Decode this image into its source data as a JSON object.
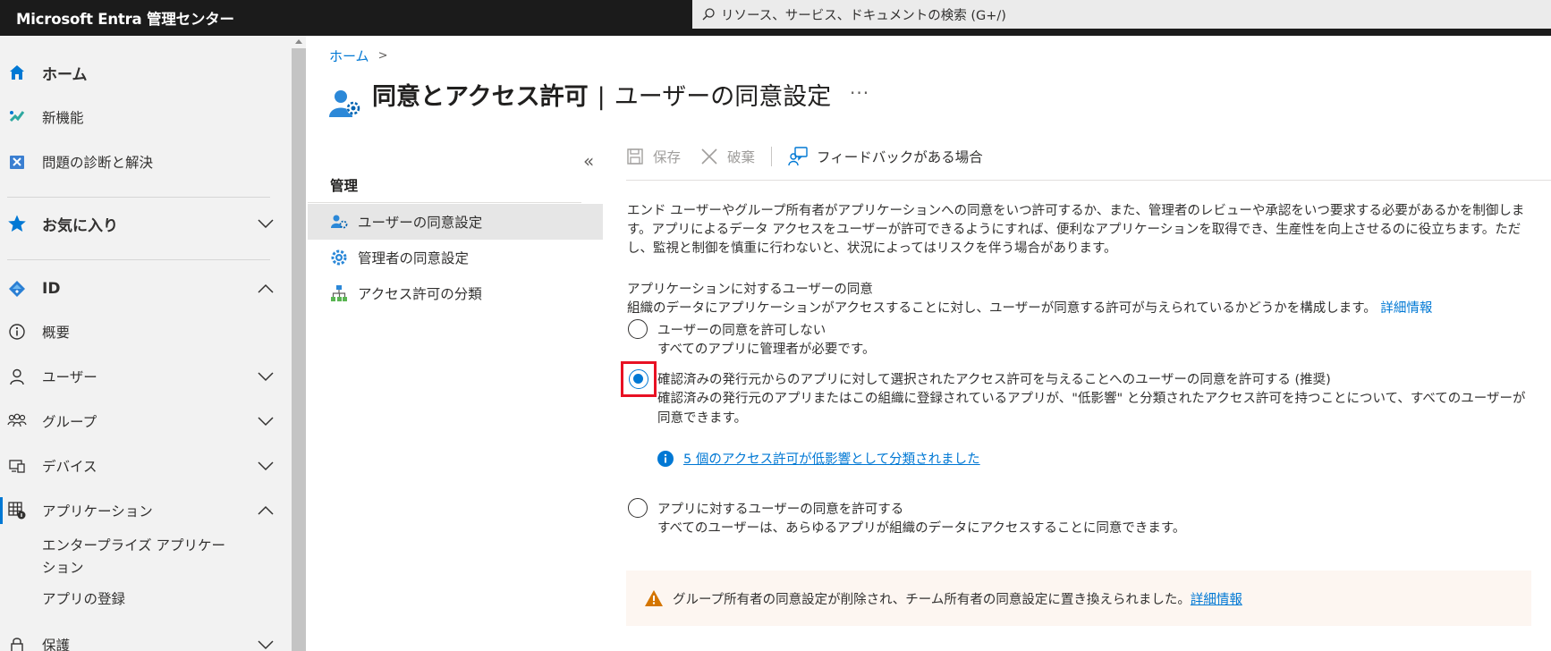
{
  "header": {
    "brand": "Microsoft Entra 管理センター",
    "search_placeholder": "リソース、サービス、ドキュメントの検索 (G+/)"
  },
  "sidebar": {
    "home": "ホーム",
    "whats_new": "新機能",
    "diagnose": "問題の診断と解決",
    "favorites": "お気に入り",
    "id": "ID",
    "overview": "概要",
    "users": "ユーザー",
    "groups": "グループ",
    "devices": "デバイス",
    "applications": "アプリケーション",
    "enterprise_apps_line1": "エンタープライズ アプリケー",
    "enterprise_apps_line2": "ション",
    "app_registrations": "アプリの登録",
    "protection": "保護"
  },
  "breadcrumb": {
    "home": "ホーム",
    "separator": ">"
  },
  "page": {
    "title_main": "同意とアクセス許可",
    "title_pipe": "|",
    "title_sub": "ユーザーの同意設定",
    "more": "···"
  },
  "resource_menu": {
    "collapse": "«",
    "heading": "管理",
    "items": [
      {
        "label": "ユーザーの同意設定"
      },
      {
        "label": "管理者の同意設定"
      },
      {
        "label": "アクセス許可の分類"
      }
    ]
  },
  "toolbar": {
    "save": "保存",
    "discard": "破棄",
    "feedback": "フィードバックがある場合"
  },
  "content": {
    "description": "エンド ユーザーやグループ所有者がアプリケーションへの同意をいつ許可するか、また、管理者のレビューや承認をいつ要求する必要があるかを制御します。アプリによるデータ アクセスをユーザーが許可できるようにすれば、便利なアプリケーションを取得でき、生産性を向上させるのに役立ちます。ただし、監視と制御を慎重に行わないと、状況によってはリスクを伴う場合があります。",
    "section_title": "アプリケーションに対するユーザーの同意",
    "section_sub": "組織のデータにアプリケーションがアクセスすることに対し、ユーザーが同意する許可が与えられているかどうかを構成します。",
    "section_link": "詳細情報",
    "options": [
      {
        "label": "ユーザーの同意を許可しない",
        "desc": "すべてのアプリに管理者が必要です。",
        "selected": false
      },
      {
        "label": "確認済みの発行元からのアプリに対して選択されたアクセス許可を与えることへのユーザーの同意を許可する (推奨)",
        "desc": "確認済みの発行元のアプリまたはこの組織に登録されているアプリが、\"低影響\" と分類されたアクセス許可を持つことについて、すべてのユーザーが同意できます。",
        "selected": true
      },
      {
        "label": "アプリに対するユーザーの同意を許可する",
        "desc": "すべてのユーザーは、あらゆるアプリが組織のデータにアクセスすることに同意できます。",
        "selected": false
      }
    ],
    "info_link": "5 個のアクセス許可が低影響として分類されました",
    "warning_text": "グループ所有者の同意設定が削除され、チーム所有者の同意設定に置き換えられました。",
    "warning_link": "詳細情報"
  },
  "colors": {
    "accent": "#0078d4",
    "topbar": "#1b1b1b",
    "highlight": "#e81123",
    "warning": "#d47500"
  }
}
